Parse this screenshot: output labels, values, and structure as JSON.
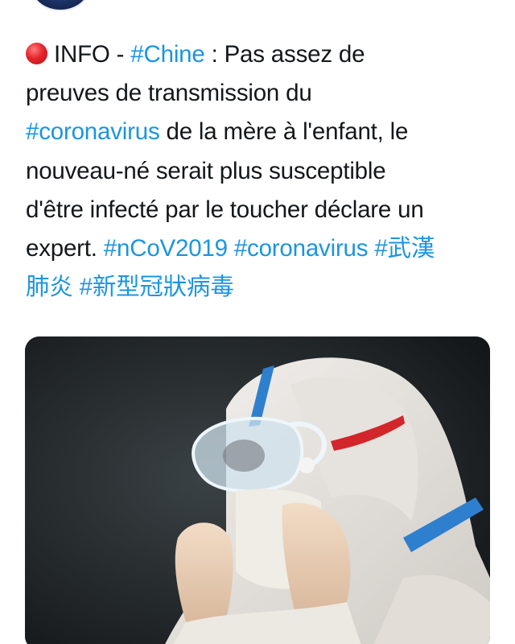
{
  "tweet": {
    "lines": [
      [
        {
          "text": "INFO - ",
          "tag": false
        },
        {
          "text": "#Chine",
          "tag": true
        },
        {
          "text": " : Pas assez de",
          "tag": false
        }
      ],
      [
        {
          "text": "preuves de transmission du",
          "tag": false
        }
      ],
      [
        {
          "text": "#coronavirus",
          "tag": true
        },
        {
          "text": " de la mère à l'enfant, le",
          "tag": false
        }
      ],
      [
        {
          "text": "nouveau-né serait plus susceptible",
          "tag": false
        }
      ],
      [
        {
          "text": "d'être infecté par le toucher déclare un",
          "tag": false
        }
      ],
      [
        {
          "text": "expert. ",
          "tag": false
        },
        {
          "text": "#nCoV2019",
          "tag": true
        },
        {
          "text": " ",
          "tag": false
        },
        {
          "text": "#coronavirus",
          "tag": true
        },
        {
          "text": " ",
          "tag": false
        },
        {
          "text": "#武漢",
          "tag": true
        }
      ],
      [
        {
          "text": "肺炎",
          "tag": true
        },
        {
          "text": " ",
          "tag": false
        },
        {
          "text": "#新型冠狀病毒",
          "tag": true
        }
      ]
    ]
  },
  "colors": {
    "hashtag": "#1b95e0",
    "text": "#14171a",
    "status_dot": "#e3262b"
  },
  "icons": {
    "status_dot": "red-circle-icon"
  }
}
